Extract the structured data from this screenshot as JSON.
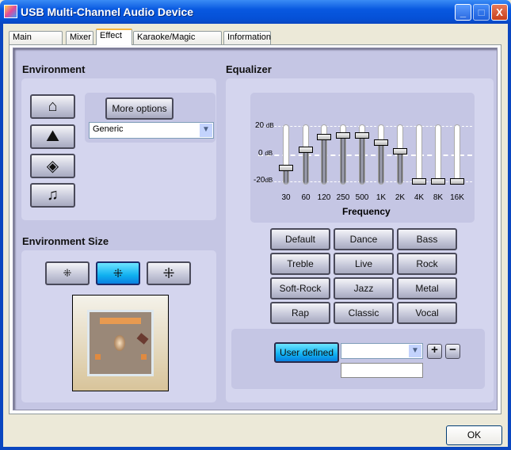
{
  "window": {
    "title": "USB Multi-Channel Audio Device",
    "minimize": "_",
    "maximize": "□",
    "close": "X"
  },
  "tabs": [
    {
      "label": "Main Setting"
    },
    {
      "label": "Mixer"
    },
    {
      "label": "Effect",
      "active": true
    },
    {
      "label": "Karaoke/Magic Voice"
    },
    {
      "label": "Information"
    }
  ],
  "environment": {
    "heading": "Environment",
    "icons": [
      "house-icon",
      "opera-house-icon",
      "underwater-icon",
      "musicians-icon"
    ],
    "more_options": "More options",
    "preset_selected": "Generic"
  },
  "environment_size": {
    "heading": "Environment Size",
    "options": [
      "small",
      "medium",
      "large"
    ],
    "selected": "medium"
  },
  "equalizer": {
    "heading": "Equalizer",
    "db_labels": {
      "top": "20",
      "mid": "0",
      "bottom": "-20",
      "unit": "dB"
    },
    "range_db": [
      -20,
      20
    ],
    "bands": [
      {
        "label": "30",
        "value": -10
      },
      {
        "label": "60",
        "value": 3
      },
      {
        "label": "120",
        "value": 12
      },
      {
        "label": "250",
        "value": 13
      },
      {
        "label": "500",
        "value": 13
      },
      {
        "label": "1K",
        "value": 8
      },
      {
        "label": "2K",
        "value": 2
      },
      {
        "label": "4K",
        "value": -20
      },
      {
        "label": "8K",
        "value": -20
      },
      {
        "label": "16K",
        "value": -20
      }
    ],
    "axis_label": "Frequency",
    "presets": [
      "Default",
      "Dance",
      "Bass",
      "Treble",
      "Live",
      "Rock",
      "Soft-Rock",
      "Jazz",
      "Metal",
      "Rap",
      "Classic",
      "Vocal"
    ],
    "user_defined": {
      "label": "User defined",
      "selected": "",
      "name_value": "",
      "add": "+",
      "remove": "−"
    }
  },
  "footer": {
    "ok": "OK"
  },
  "colors": {
    "accent": "#1ab0f0",
    "panel": "#c5c6e4",
    "titlebar": "#0550d6"
  }
}
